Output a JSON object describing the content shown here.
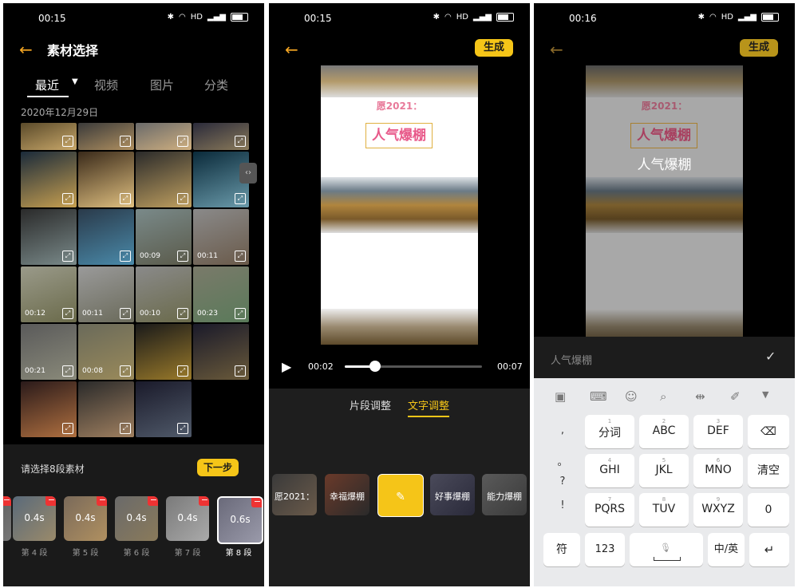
{
  "colors": {
    "accent": "#f5c518",
    "back_arrow": "#f5a623",
    "remove": "#e33333"
  },
  "panel1": {
    "time": "00:15",
    "title": "素材选择",
    "tabs": [
      "最近",
      "视频",
      "图片",
      "分类"
    ],
    "date_header": "2020年12月29日",
    "grid_durations": [
      "",
      "",
      "",
      "",
      "",
      "",
      "",
      "",
      "",
      "",
      "00:09",
      "00:11",
      "00:12",
      "00:11",
      "00:10",
      "00:23",
      "00:21",
      "00:08",
      "",
      "",
      "",
      "",
      ""
    ],
    "prompt": "请选择8段素材",
    "next_button": "下一步",
    "segments": [
      {
        "duration": "",
        "label": ""
      },
      {
        "duration": "0.4s",
        "label": "第 4 段"
      },
      {
        "duration": "0.4s",
        "label": "第 5 段"
      },
      {
        "duration": "0.4s",
        "label": "第 6 段"
      },
      {
        "duration": "0.4s",
        "label": "第 7 段"
      },
      {
        "duration": "0.6s",
        "label": "第 8 段"
      }
    ]
  },
  "panel2": {
    "time": "00:15",
    "generate_button": "生成",
    "video_text_top": "愿2021：",
    "video_text_main": "人气爆棚",
    "current_time": "00:02",
    "total_time": "00:07",
    "progress": 0.22,
    "tabs": [
      "片段调整",
      "文字调整"
    ],
    "active_tab": "文字调整",
    "text_chips": [
      "愿2021：",
      "幸福爆棚",
      "",
      "好事爆棚",
      "能力爆棚"
    ]
  },
  "panel3": {
    "time": "00:16",
    "generate_button": "生成",
    "video_text_top": "愿2021：",
    "video_text_main": "人气爆棚",
    "video_text_editing": "人气爆棚",
    "input_value": "人气爆棚",
    "keyboard": {
      "side_symbols": [
        ",",
        "。",
        "?",
        "!"
      ],
      "rows": [
        [
          {
            "sup": "1",
            "main": "分词"
          },
          {
            "sup": "2",
            "main": "ABC"
          },
          {
            "sup": "3",
            "main": "DEF"
          }
        ],
        [
          {
            "sup": "4",
            "main": "GHI"
          },
          {
            "sup": "5",
            "main": "JKL"
          },
          {
            "sup": "6",
            "main": "MNO"
          }
        ],
        [
          {
            "sup": "7",
            "main": "PQRS"
          },
          {
            "sup": "8",
            "main": "TUV"
          },
          {
            "sup": "9",
            "main": "WXYZ"
          }
        ]
      ],
      "clear": "清空",
      "zero": "0",
      "symbol": "符",
      "num": "123",
      "lang": "中/英"
    }
  }
}
